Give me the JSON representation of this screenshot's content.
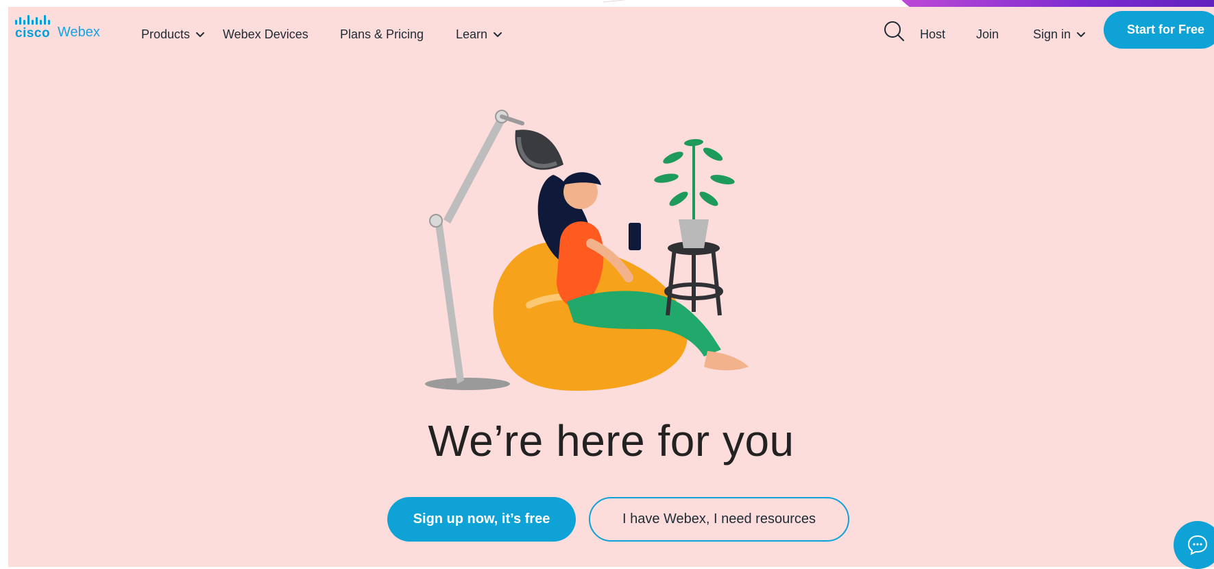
{
  "brand": {
    "cisco_text": "cisco",
    "product_text": "Webex",
    "accent_color": "#0ea2d6",
    "background_color": "#fddcdc"
  },
  "nav": {
    "items": [
      {
        "label": "Products",
        "has_dropdown": true
      },
      {
        "label": "Webex Devices",
        "has_dropdown": false
      },
      {
        "label": "Plans & Pricing",
        "has_dropdown": false
      },
      {
        "label": "Learn",
        "has_dropdown": true
      }
    ],
    "right": {
      "search_icon": "search-icon",
      "host": "Host",
      "join": "Join",
      "sign_in": "Sign in",
      "start_free": "Start for Free"
    }
  },
  "hero": {
    "headline": "We’re here for you",
    "primary_cta": "Sign up now, it’s free",
    "secondary_cta": "I have Webex, I need resources"
  },
  "widgets": {
    "chat_icon": "chat-icon"
  }
}
